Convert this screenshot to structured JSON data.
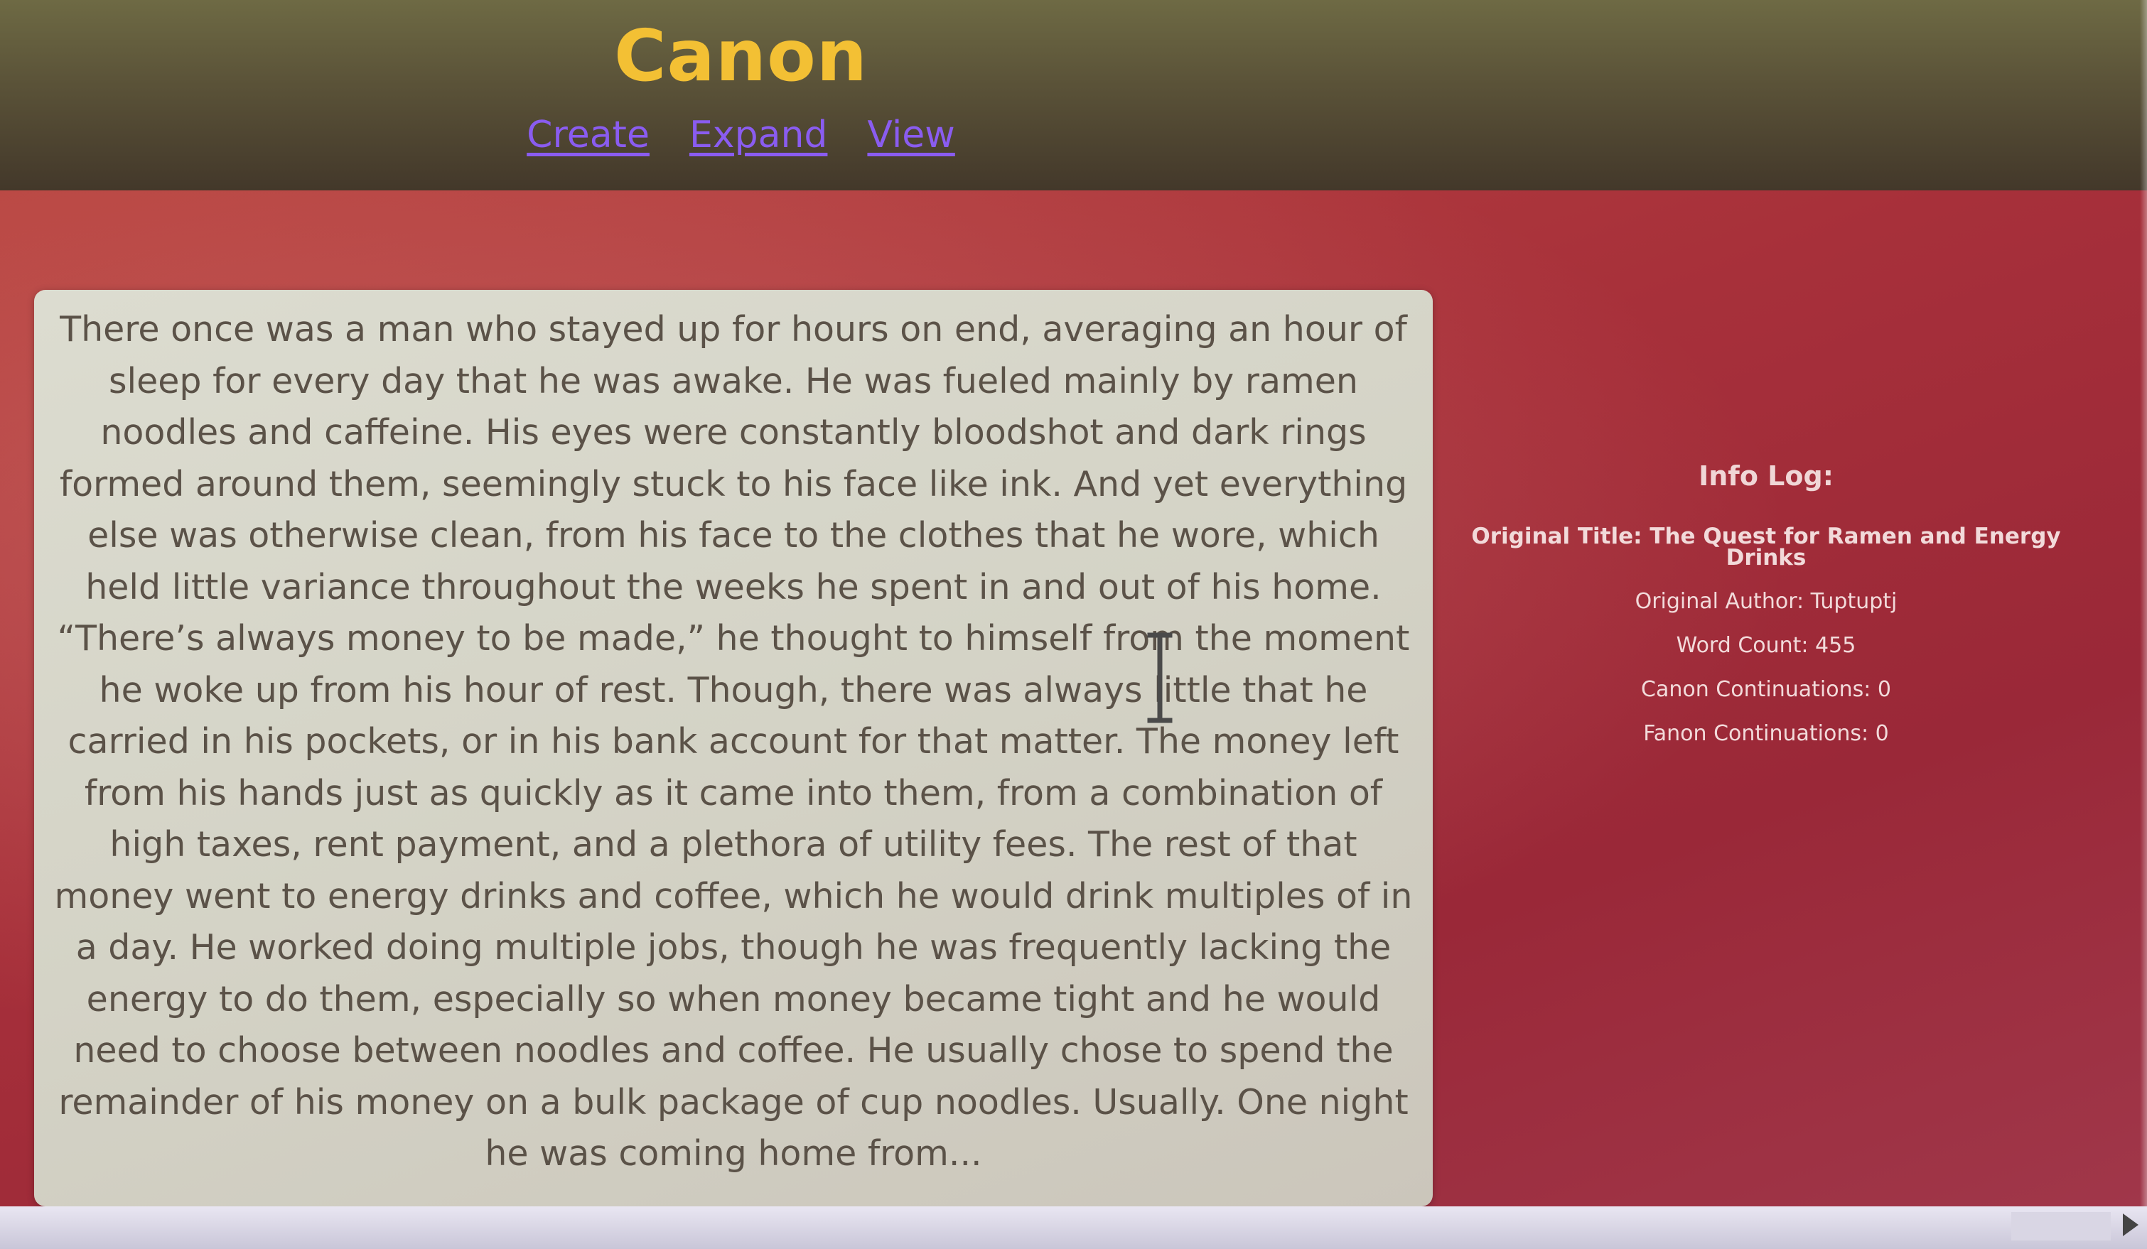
{
  "site": {
    "title": "Canon"
  },
  "nav": {
    "items": [
      {
        "label": "Create"
      },
      {
        "label": "Expand"
      },
      {
        "label": "View"
      }
    ]
  },
  "story": {
    "text": "There once was a man who stayed up for hours on end, averaging an hour of sleep for every day that he was awake. He was fueled mainly by ramen noodles and caffeine. His eyes were constantly bloodshot and dark rings formed around them, seemingly stuck to his face like ink. And yet everything else was otherwise clean, from his face to the clothes that he wore, which held little variance throughout the weeks he spent in and out of his home. “There’s always money to be made,” he thought to himself from the moment he woke up from his hour of rest. Though, there was always little that he carried in his pockets, or in his bank account for that matter. The money left from his hands just as quickly as it came into them, from a combination of high taxes, rent payment, and a plethora of utility fees. The rest of that money went to energy drinks and coffee, which he would drink multiples of in a day. He worked doing multiple jobs, though he was frequently lacking the energy to do them, especially so when money became tight and he would need to choose between noodles and coffee. He usually chose to spend the remainder of his money on a bulk package of cup noodles. Usually. One night he was coming home from..."
  },
  "info_log": {
    "title": "Info Log:",
    "original_title": "Original Title: The Quest for Ramen and Energy Drinks",
    "original_author": "Original Author: Tuptuptj",
    "word_count": "Word Count: 455",
    "canon_continuations": "Canon Continuations: 0",
    "fanon_continuations": "Fanon Continuations: 0"
  },
  "colors": {
    "title": "#f3c034",
    "link": "#8a5cf0",
    "background_red": "#a7303a",
    "card": "#d6d5c9",
    "story_text": "#5b5248"
  },
  "icons": {
    "cursor": "text-cursor-ibeam-icon",
    "scroll_right": "scroll-right-arrow-icon"
  }
}
